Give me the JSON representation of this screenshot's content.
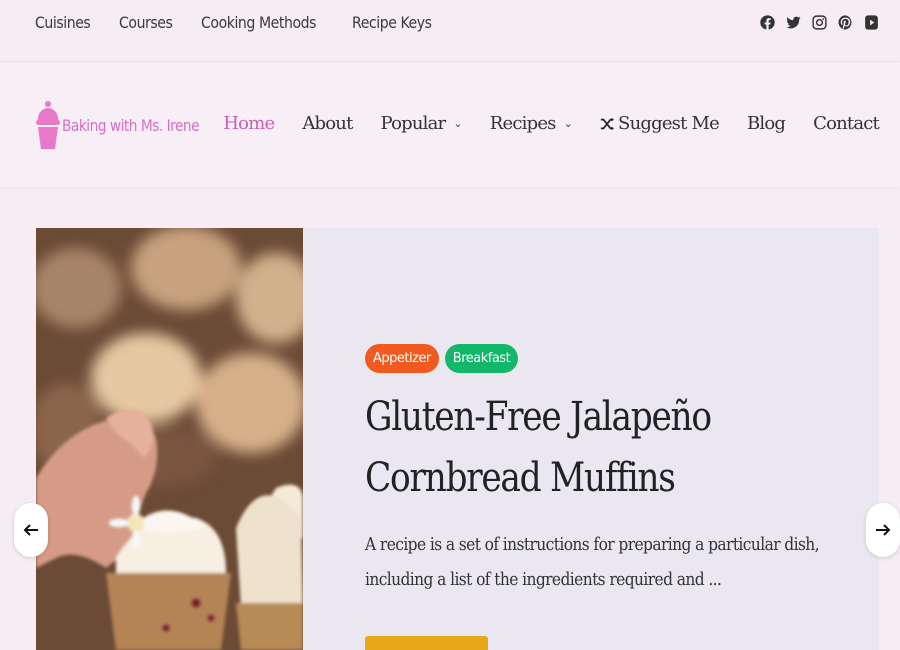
{
  "topbar": {
    "links": [
      "Cuisines",
      "Courses",
      "Cooking Methods",
      "Recipe Keys"
    ],
    "social_icons": [
      "facebook-icon",
      "twitter-icon",
      "instagram-icon",
      "pinterest-icon",
      "youtube-icon"
    ]
  },
  "header": {
    "logo_text": "Baking with Ms. Irene",
    "nav": [
      {
        "label": "Home",
        "active": true
      },
      {
        "label": "About"
      },
      {
        "label": "Popular",
        "dropdown": true
      },
      {
        "label": "Recipes",
        "dropdown": true
      },
      {
        "label": "Suggest Me",
        "icon": "shuffle-icon"
      },
      {
        "label": "Blog"
      },
      {
        "label": "Contact"
      }
    ]
  },
  "slide": {
    "tags": [
      "Appetizer",
      "Breakfast"
    ],
    "title_line1": "Gluten-Free Jalapeño",
    "title_line2": "Cornbread Muffins",
    "excerpt_line1": "A recipe is a set of instructions for preparing a particular dish,",
    "excerpt_line2": "including a list of the ingredients required and ..."
  },
  "colors": {
    "accent": "#c85fbb",
    "logo": "#d86fc5",
    "tag_appetizer": "#f15a1f",
    "tag_breakfast": "#12b76a",
    "button": "#e9a81a",
    "background": "#f5ecf4"
  }
}
